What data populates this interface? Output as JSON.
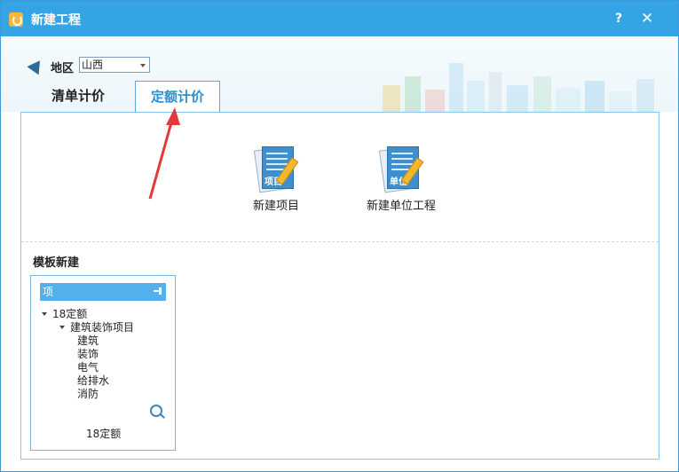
{
  "window": {
    "title": "新建工程",
    "help_label": "?",
    "close_label": "✕"
  },
  "region": {
    "label": "地区",
    "selected": "山西"
  },
  "tabs": [
    {
      "label": "清单计价",
      "active": false
    },
    {
      "label": "定额计价",
      "active": true
    }
  ],
  "tiles": [
    {
      "tag": "项目",
      "label": "新建项目",
      "icon": "document-pencil-icon"
    },
    {
      "tag": "单位",
      "label": "新建单位工程",
      "icon": "document-pencil-icon"
    }
  ],
  "template_section": {
    "title": "模板新建",
    "panel_header": "项",
    "tree": {
      "root": "18定额",
      "child": "建筑装饰项目",
      "leaves": [
        "建筑",
        "装饰",
        "电气",
        "给排水",
        "消防"
      ]
    },
    "footer": "18定额"
  },
  "colors": {
    "titlebar": "#34a4e4",
    "tab_active_text": "#2a8fd3",
    "annotation_arrow": "#e23a3a"
  }
}
